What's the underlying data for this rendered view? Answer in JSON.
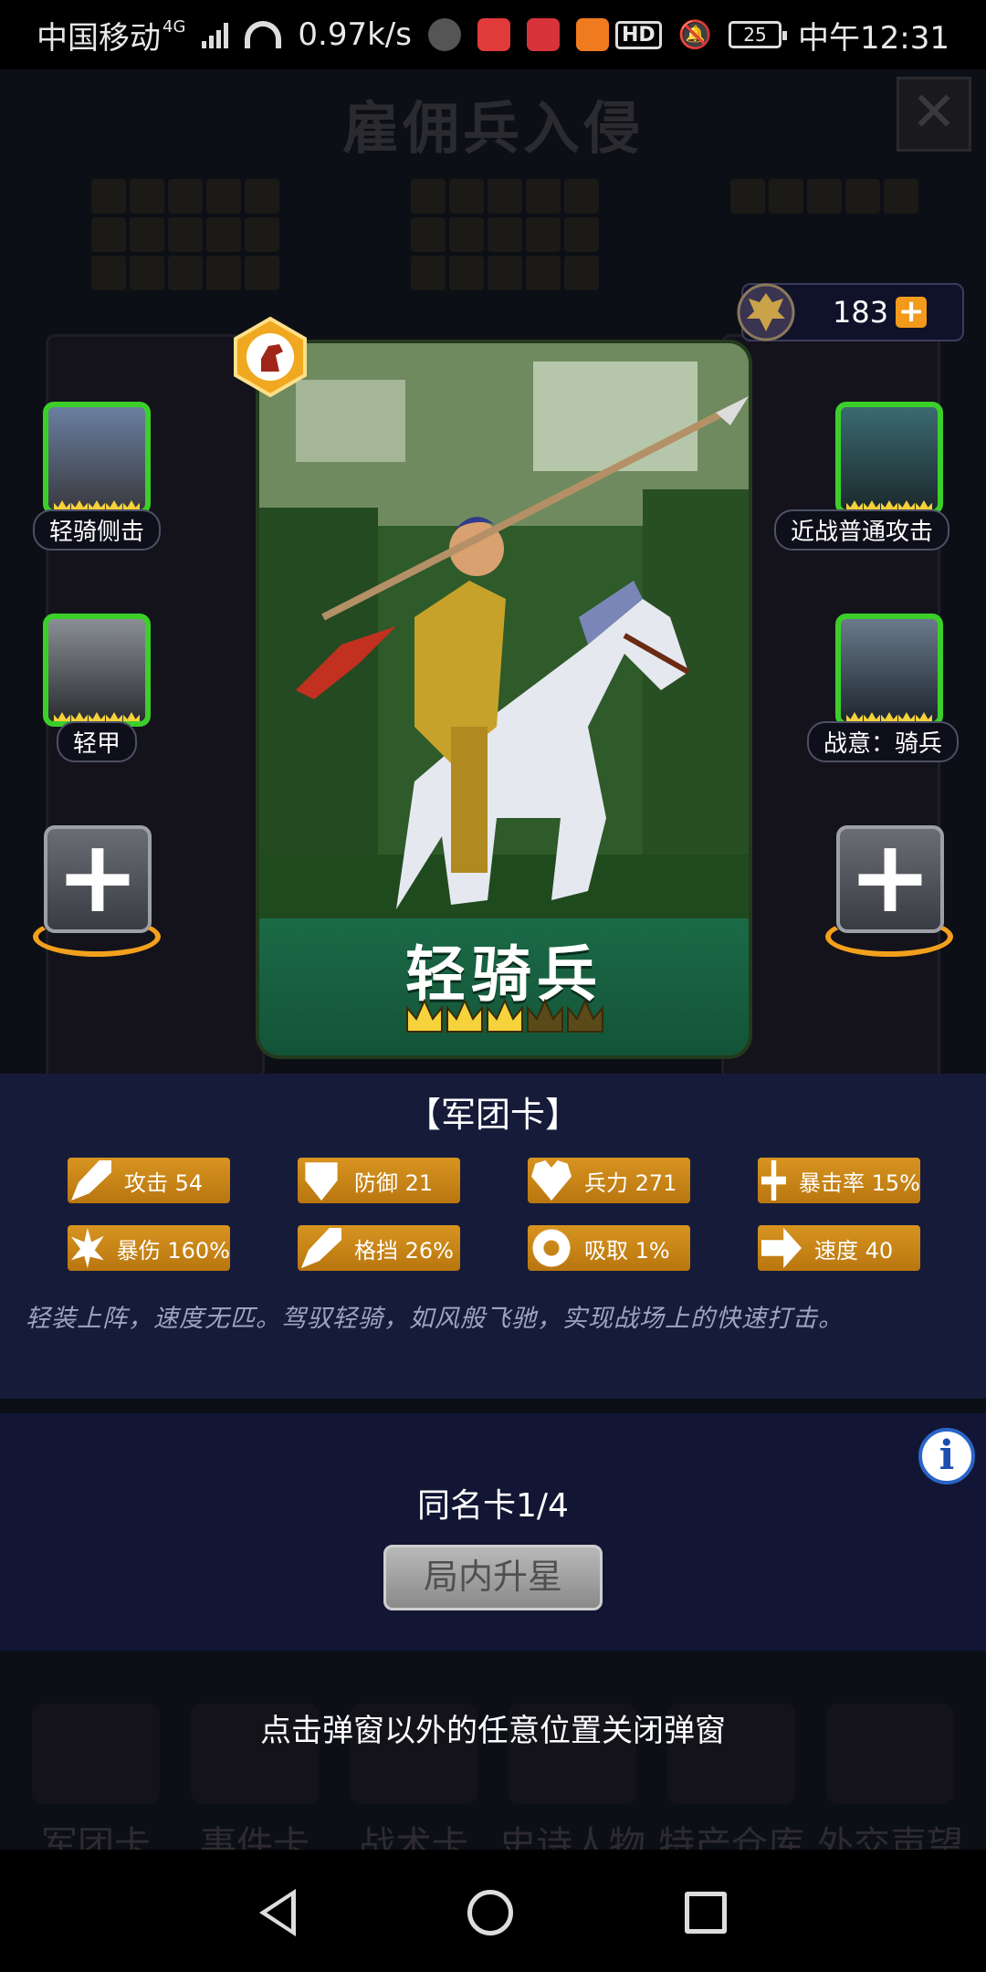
{
  "status_bar": {
    "carrier": "中国移动",
    "network": "4G",
    "speed": "0.97k/s",
    "hd": "HD",
    "battery": "25",
    "time": "中午12:31"
  },
  "background": {
    "title": "雇佣兵入侵",
    "close": "✕",
    "nav": [
      "军团卡",
      "事件卡",
      "战术卡",
      "史诗人物",
      "特产仓库",
      "外交声望"
    ]
  },
  "currency": {
    "value": "183",
    "plus": "+"
  },
  "card": {
    "name": "轻骑兵",
    "stars_filled": 3,
    "stars_total": 5
  },
  "skills": {
    "left_top": "轻骑侧击",
    "left_mid": "轻甲",
    "right_top": "近战普通攻击",
    "right_mid": "战意：骑兵"
  },
  "add_slot": "+",
  "info": {
    "title": "【军团卡】",
    "stats": [
      {
        "icon": "sword-icon",
        "label": "攻击 54"
      },
      {
        "icon": "shield-icon",
        "label": "防御 21"
      },
      {
        "icon": "heart-icon",
        "label": "兵力 271"
      },
      {
        "icon": "crosshair-icon",
        "label": "暴击率 15%"
      },
      {
        "icon": "burst-icon",
        "label": "暴伤 160%"
      },
      {
        "icon": "parry-icon",
        "label": "格挡 26%"
      },
      {
        "icon": "absorb-icon",
        "label": "吸取 1%"
      },
      {
        "icon": "speed-icon",
        "label": "速度 40"
      }
    ],
    "description": "轻装上阵，速度无匹。驾驭轻骑，如风般飞驰，实现战场上的快速打击。"
  },
  "lower": {
    "info_icon": "i",
    "duplicate_count": "同名卡1/4",
    "upgrade_button": "局内升星"
  },
  "close_hint": "点击弹窗以外的任意位置关闭弹窗",
  "colors": {
    "accent_orange": "#d79420",
    "skill_border": "#3ccf2a",
    "panel_bg": "#161b3a",
    "name_bar": "#1b6a46"
  }
}
